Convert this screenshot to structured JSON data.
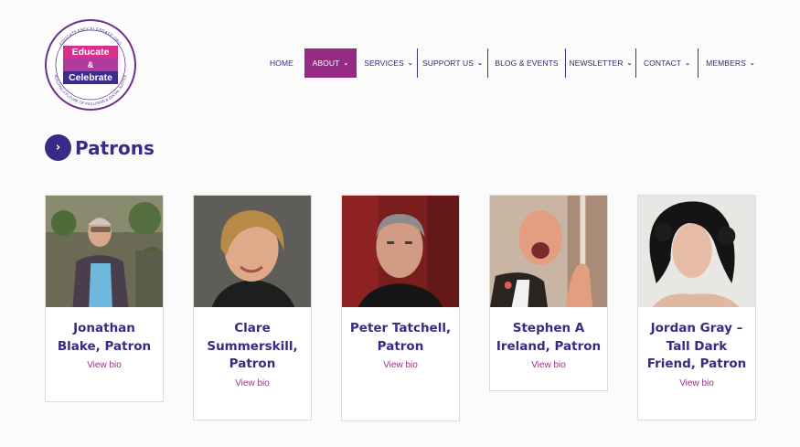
{
  "logo": {
    "line1": "Educate",
    "line2": "&",
    "line3": "Celebrate",
    "ring_top": "EDUCATEANDCELEBRATE.ORG",
    "ring_bottom": "BUILDING A FUTURE OF INCLUSION & SOCIAL JUSTICE"
  },
  "nav": {
    "items": [
      {
        "label": "HOME",
        "dropdown": false
      },
      {
        "label": "ABOUT",
        "dropdown": true,
        "active": true
      },
      {
        "label": "SERVICES",
        "dropdown": true
      },
      {
        "label": "SUPPORT US",
        "dropdown": true
      },
      {
        "label": "BLOG & EVENTS",
        "dropdown": false
      },
      {
        "label": "NEWSLETTER",
        "dropdown": true
      },
      {
        "label": "CONTACT",
        "dropdown": true
      },
      {
        "label": "MEMBERS",
        "dropdown": true
      }
    ],
    "chevron_icon": "chevron-down-icon"
  },
  "heading": {
    "title": "Patrons",
    "icon": "chevron-right-icon"
  },
  "patrons": [
    {
      "name": "Jonathan Blake, Patron",
      "link": "View bio"
    },
    {
      "name": "Clare Summerskill, Patron",
      "link": "View bio"
    },
    {
      "name": "Peter Tatchell, Patron",
      "link": "View bio"
    },
    {
      "name": "Stephen A Ireland, Patron",
      "link": "View bio"
    },
    {
      "name": "Jordan Gray – Tall Dark Friend, Patron",
      "link": "View bio"
    }
  ],
  "colors": {
    "brand_purple": "#352c84",
    "accent_magenta": "#962b86",
    "link_magenta": "#9a2f8a"
  }
}
